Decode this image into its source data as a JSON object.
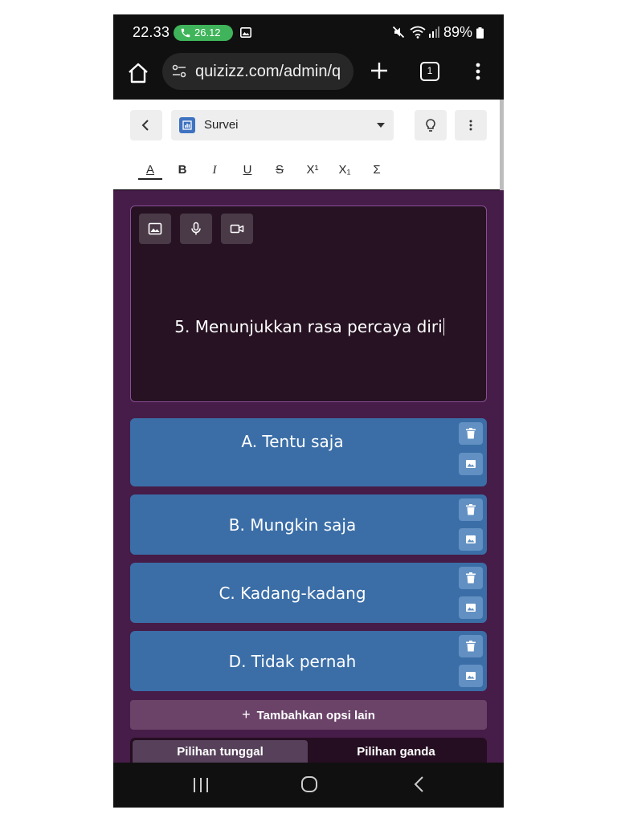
{
  "status_bar": {
    "time": "22.33",
    "call_duration": "26.12",
    "battery": "89%"
  },
  "browser": {
    "url": "quizizz.com/admin/q",
    "tab_count": "1"
  },
  "header": {
    "question_type": "Survei"
  },
  "toolbar": {
    "text_color": "A",
    "bold": "B",
    "italic": "I",
    "underline": "U",
    "strikethrough": "S",
    "superscript": "X¹",
    "subscript": "X₁",
    "equation": "Σ"
  },
  "question": {
    "text": "5. Menunjukkan rasa percaya diri"
  },
  "options": [
    {
      "text": "A. Tentu saja"
    },
    {
      "text": "B. Mungkin saja"
    },
    {
      "text": "C. Kadang-kadang"
    },
    {
      "text": "D. Tidak pernah"
    }
  ],
  "add_option_label": "Tambahkan opsi lain",
  "answer_mode": {
    "single": "Pilihan tunggal",
    "multiple": "Pilihan ganda"
  },
  "colors": {
    "background": "#461c48",
    "question_box": "#261223",
    "option_card": "#3b6ea7",
    "call_pill": "#3fb45a"
  }
}
